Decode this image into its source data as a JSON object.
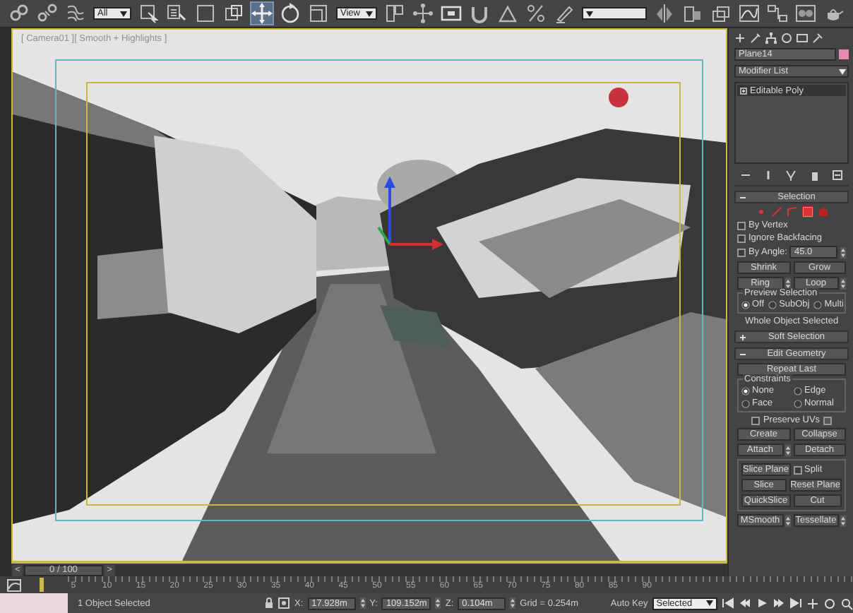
{
  "toolbar": {
    "selection_filter": "All",
    "reference_coordinate": "View",
    "transform_tools": [
      {
        "kind": "move",
        "selected": true
      },
      {
        "kind": "rotate",
        "selected": false
      },
      {
        "kind": "scale",
        "selected": false
      }
    ]
  },
  "viewport": {
    "label": "[ Camera01 ][ Smooth + Highlights ]"
  },
  "command_panel": {
    "object_name": "Plane14",
    "modifier_list": "Modifier List",
    "modifier_stack": [
      {
        "label": "Editable Poly",
        "selected": true
      }
    ],
    "rollouts": [
      {
        "title": "Selection",
        "expanded": true,
        "rows": [
          {
            "kind": "levels",
            "levels": [
              {
                "kind": "vertex",
                "selected": false
              },
              {
                "kind": "edge",
                "selected": false
              },
              {
                "kind": "border",
                "selected": false
              },
              {
                "kind": "polygon",
                "selected": true
              },
              {
                "kind": "element",
                "selected": false
              }
            ]
          },
          {
            "kind": "check",
            "label": "By Vertex",
            "checked": false
          },
          {
            "kind": "check",
            "label": "Ignore Backfacing",
            "checked": false
          },
          {
            "kind": "check-spin",
            "label": "By Angle:",
            "checked": false,
            "value": "45.0"
          },
          {
            "kind": "buttons",
            "items": [
              {
                "kind": "button",
                "label": "Shrink",
                "spinner": false
              },
              {
                "kind": "button",
                "label": "Grow",
                "spinner": false
              }
            ]
          },
          {
            "kind": "buttons",
            "items": [
              {
                "kind": "button",
                "label": "Ring",
                "spinner": true
              },
              {
                "kind": "button",
                "label": "Loop",
                "spinner": true
              }
            ]
          },
          {
            "kind": "radio-group",
            "title": "Preview Selection",
            "options": [
              {
                "label": "Off",
                "selected": true
              },
              {
                "label": "SubObj",
                "selected": false
              },
              {
                "label": "Multi",
                "selected": false
              }
            ]
          },
          {
            "kind": "text",
            "label": "Whole Object Selected"
          }
        ]
      },
      {
        "title": "Soft Selection",
        "expanded": false
      },
      {
        "title": "Edit Geometry",
        "expanded": true,
        "rows": [
          {
            "kind": "buttons",
            "items": [
              {
                "kind": "button",
                "label": "Repeat Last",
                "spinner": false
              }
            ]
          },
          {
            "kind": "radio-group",
            "title": "Constraints",
            "options": [
              {
                "label": "None",
                "selected": true
              },
              {
                "label": "Edge",
                "selected": false
              },
              {
                "label": "Face",
                "selected": false
              },
              {
                "label": "Normal",
                "selected": false
              }
            ]
          },
          {
            "kind": "check-settings",
            "label": "Preserve UVs",
            "checked": false
          },
          {
            "kind": "buttons",
            "items": [
              {
                "kind": "button",
                "label": "Create",
                "spinner": false
              },
              {
                "kind": "button",
                "label": "Collapse",
                "spinner": false
              }
            ]
          },
          {
            "kind": "buttons",
            "items": [
              {
                "kind": "button",
                "label": "Attach",
                "spinner": true
              },
              {
                "kind": "button",
                "label": "Detach",
                "spinner": false
              }
            ]
          },
          {
            "kind": "group",
            "rows": [
              {
                "kind": "buttons",
                "items": [
                  {
                    "kind": "button",
                    "label": "Slice Plane",
                    "spinner": false
                  },
                  {
                    "kind": "check",
                    "label": "Split",
                    "checked": false
                  }
                ]
              },
              {
                "kind": "buttons",
                "items": [
                  {
                    "kind": "button",
                    "label": "Slice",
                    "spinner": false
                  },
                  {
                    "kind": "button",
                    "label": "Reset Plane",
                    "spinner": false
                  }
                ]
              },
              {
                "kind": "buttons",
                "items": [
                  {
                    "kind": "button",
                    "label": "QuickSlice",
                    "spinner": false
                  },
                  {
                    "kind": "button",
                    "label": "Cut",
                    "spinner": false
                  }
                ]
              }
            ]
          },
          {
            "kind": "buttons",
            "items": [
              {
                "kind": "button",
                "label": "MSmooth",
                "spinner": true
              },
              {
                "kind": "button",
                "label": "Tessellate",
                "spinner": true
              }
            ]
          }
        ]
      }
    ]
  },
  "time_slider": {
    "previous": "<",
    "position": "0 / 100",
    "next": ">"
  },
  "track_bar": {
    "frame_labels": [
      "5",
      "10",
      "15",
      "20",
      "25",
      "30",
      "35",
      "40",
      "45",
      "50",
      "55",
      "60",
      "65",
      "70",
      "75",
      "80",
      "85",
      "90"
    ]
  },
  "status_bar": {
    "message": "1 Object Selected",
    "x_label": "X:",
    "x": "17.928m",
    "y_label": "Y:",
    "y": "109.152m",
    "z_label": "Z:",
    "z": "0.104m",
    "grid": "Grid = 0.254m",
    "auto_key": "Auto Key",
    "key_filter": "Selected"
  }
}
